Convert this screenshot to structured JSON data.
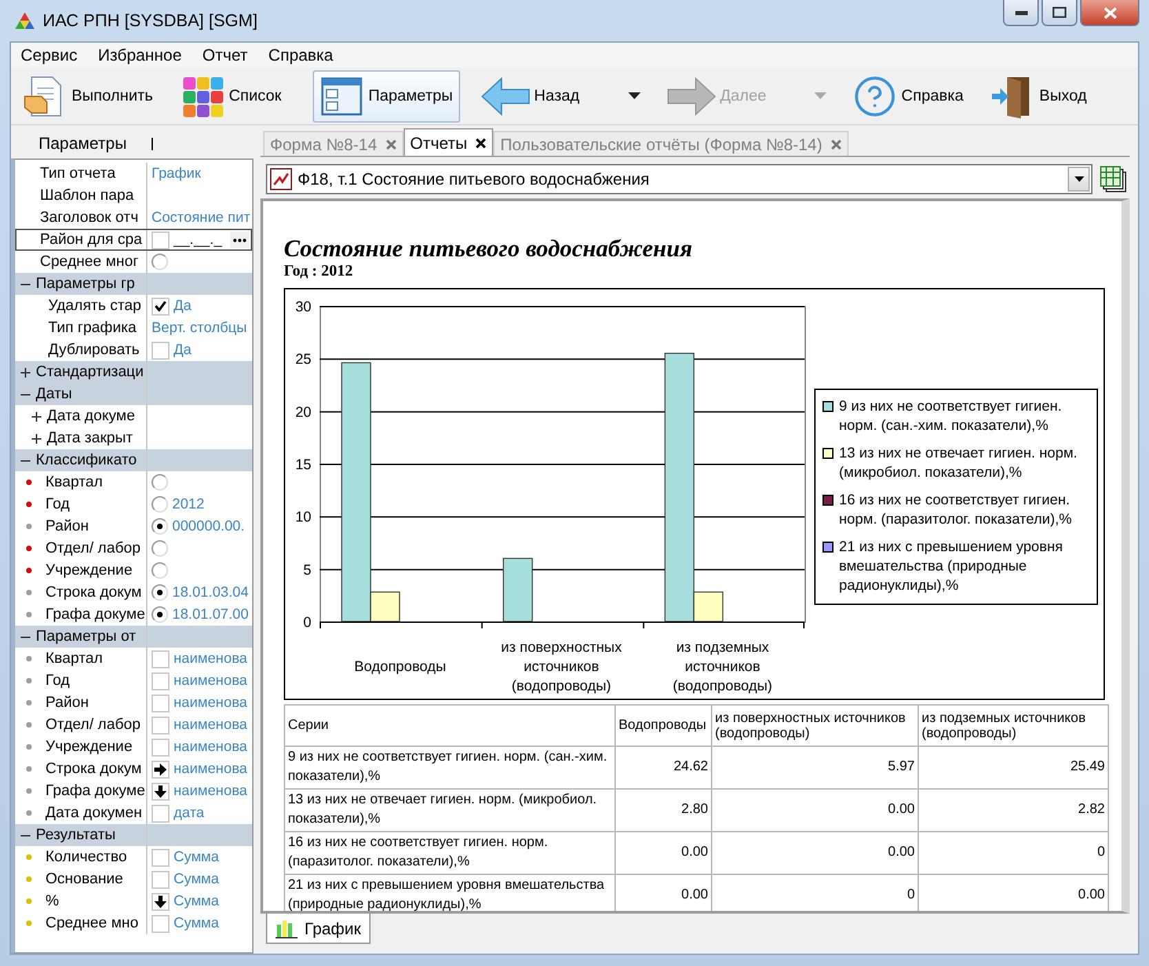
{
  "window": {
    "title": "ИАС РПН [SYSDBA] [SGM]"
  },
  "menu": [
    "Сервис",
    "Избранное",
    "Отчет",
    "Справка"
  ],
  "toolbar": [
    {
      "label": "Выполнить",
      "selected": false,
      "disabled": false,
      "dropdown": false
    },
    {
      "label": "Список",
      "selected": false,
      "disabled": false,
      "dropdown": false
    },
    {
      "label": "Параметры",
      "selected": true,
      "disabled": false,
      "dropdown": false
    },
    {
      "label": "Назад",
      "selected": false,
      "disabled": false,
      "dropdown": true
    },
    {
      "label": "Далее",
      "selected": false,
      "disabled": true,
      "dropdown": true
    },
    {
      "label": "Справка",
      "selected": false,
      "disabled": false,
      "dropdown": false
    },
    {
      "label": "Выход",
      "selected": false,
      "disabled": false,
      "dropdown": false
    }
  ],
  "params": {
    "title": "Параметры",
    "rows": [
      {
        "kind": "field",
        "label": "Тип отчета",
        "value": "График",
        "selected": false
      },
      {
        "kind": "field",
        "label": "Шаблон пара",
        "selected": false
      },
      {
        "kind": "field",
        "label": "Заголовок отч",
        "value": "Состояние пит",
        "selected": false
      },
      {
        "kind": "field",
        "label": "Район для сра",
        "control": {
          "kind": "checkbox",
          "checked": false
        },
        "placeholder": "__.__._",
        "browse_button": true,
        "selected": true
      },
      {
        "kind": "field",
        "label": "Среднее мног",
        "control": {
          "kind": "radio",
          "checked": false
        },
        "selected": false
      },
      {
        "kind": "group",
        "label": "Параметры гр",
        "expanded": true,
        "selected": false,
        "children": [
          {
            "kind": "field",
            "label": "Удалять стар",
            "control": {
              "kind": "checkbox",
              "checked": true
            },
            "value": "Да",
            "selected": false
          },
          {
            "kind": "field",
            "label": "Тип графика",
            "value": "Верт. столбцы",
            "selected": false
          },
          {
            "kind": "field",
            "label": "Дублировать",
            "control": {
              "kind": "checkbox",
              "checked": false
            },
            "value": "Да",
            "selected": false
          }
        ]
      },
      {
        "kind": "group",
        "label": "Стандартизаци",
        "expanded": false,
        "selected": false
      },
      {
        "kind": "group",
        "label": "Даты",
        "expanded": true,
        "selected": false,
        "children": [
          {
            "kind": "group",
            "label": "Дата докуме",
            "expanded": false,
            "selected": false
          },
          {
            "kind": "group",
            "label": "Дата закрыт",
            "expanded": false,
            "selected": false
          }
        ]
      },
      {
        "kind": "group",
        "label": "Классификато",
        "expanded": true,
        "selected": false,
        "children": [
          {
            "kind": "field",
            "label": "Квартал",
            "color": "#d01010",
            "control": {
              "kind": "radio",
              "checked": false
            },
            "selected": false
          },
          {
            "kind": "field",
            "label": "Год",
            "color": "#d01010",
            "control": {
              "kind": "radio",
              "checked": false
            },
            "value": "2012",
            "selected": false
          },
          {
            "kind": "field",
            "label": "Район",
            "color": "#a0a0a0",
            "control": {
              "kind": "radio",
              "checked": true
            },
            "value": "000000.00.",
            "selected": false
          },
          {
            "kind": "field",
            "label": "Отдел/ лабор",
            "color": "#d01010",
            "control": {
              "kind": "radio",
              "checked": false
            },
            "selected": false
          },
          {
            "kind": "field",
            "label": "Учреждение",
            "color": "#d01010",
            "control": {
              "kind": "radio",
              "checked": false
            },
            "selected": false
          },
          {
            "kind": "field",
            "label": "Строка докум",
            "color": "#a0a0a0",
            "control": {
              "kind": "radio",
              "checked": true
            },
            "value": "18.01.03.04",
            "selected": false
          },
          {
            "kind": "field",
            "label": "Графа докуме",
            "color": "#a0a0a0",
            "control": {
              "kind": "radio",
              "checked": true
            },
            "value": "18.01.07.00",
            "selected": false
          }
        ]
      },
      {
        "kind": "group",
        "label": "Параметры от",
        "expanded": true,
        "selected": false,
        "children": [
          {
            "kind": "field",
            "label": "Квартал",
            "color": "#a0a0a0",
            "control": {
              "kind": "checkbox",
              "checked": false
            },
            "value": "наименова",
            "selected": false
          },
          {
            "kind": "field",
            "label": "Год",
            "color": "#a0a0a0",
            "control": {
              "kind": "checkbox",
              "checked": false
            },
            "value": "наименова",
            "selected": false
          },
          {
            "kind": "field",
            "label": "Район",
            "color": "#a0a0a0",
            "control": {
              "kind": "checkbox",
              "checked": false
            },
            "value": "наименова",
            "selected": false
          },
          {
            "kind": "field",
            "label": "Отдел/ лабор",
            "color": "#a0a0a0",
            "control": {
              "kind": "checkbox",
              "checked": false
            },
            "value": "наименова",
            "selected": false
          },
          {
            "kind": "field",
            "label": "Учреждение",
            "color": "#a0a0a0",
            "control": {
              "kind": "checkbox",
              "checked": false
            },
            "value": "наименова",
            "selected": false
          },
          {
            "kind": "field",
            "label": "Строка докум",
            "color": "#a0a0a0",
            "control": {
              "kind": "arrow_right"
            },
            "value": "наименова",
            "selected": false
          },
          {
            "kind": "field",
            "label": "Графа докуме",
            "color": "#a0a0a0",
            "control": {
              "kind": "arrow_down"
            },
            "value": "наименова",
            "selected": false
          },
          {
            "kind": "field",
            "label": "Дата докумен",
            "color": "#a0a0a0",
            "control": {
              "kind": "checkbox",
              "checked": false
            },
            "value": "дата",
            "selected": false
          }
        ]
      },
      {
        "kind": "group",
        "label": "Результаты",
        "expanded": true,
        "selected": false,
        "children": [
          {
            "kind": "field",
            "label": "Количество",
            "color": "#d4c400",
            "control": {
              "kind": "checkbox",
              "checked": false
            },
            "value": "Сумма",
            "selected": false
          },
          {
            "kind": "field",
            "label": "Основание",
            "color": "#d4c400",
            "control": {
              "kind": "checkbox",
              "checked": false
            },
            "value": "Сумма",
            "selected": false
          },
          {
            "kind": "field",
            "label": "%",
            "color": "#d4c400",
            "control": {
              "kind": "arrow_down"
            },
            "value": "Сумма",
            "selected": false
          },
          {
            "kind": "field",
            "label": "Среднее мно",
            "color": "#d4c400",
            "control": {
              "kind": "checkbox",
              "checked": false
            },
            "value": "Сумма",
            "selected": false
          }
        ]
      }
    ]
  },
  "tabs": [
    {
      "label": "Форма №8-14",
      "selected": false
    },
    {
      "label": "Отчеты",
      "selected": true
    },
    {
      "label": "Пользовательские отчёты (Форма №8-14)",
      "selected": false
    }
  ],
  "report_selector": {
    "value": "Ф18, т.1 Состояние питьевого водоснабжения"
  },
  "report": {
    "title": "Состояние питьевого водоснабжения",
    "subtitle": "Год : 2012",
    "chart_data": {
      "type": "bar",
      "categories": [
        "Водопроводы",
        "из поверхностных источников (водопроводы)",
        "из подземных источников (водопроводы)"
      ],
      "series": [
        {
          "name": "9 из них не соответствует гигиен. норм. (сан.-хим. показатели),%",
          "color": "#a6dedc",
          "values": [
            24.6,
            6,
            25.5
          ]
        },
        {
          "name": "13 из них не отвечает гигиен. норм. (микробиол. показатели),%",
          "color": "#ffffc0",
          "values": [
            2.8,
            0,
            2.8
          ]
        },
        {
          "name": "16 из них не соответствует гигиен. норм. (паразитолог. показатели),%",
          "color": "#7a2048",
          "values": [
            0,
            0,
            0
          ]
        },
        {
          "name": "21 из них с превышением уровня вмешательства (природные радионуклиды),%",
          "color": "#9999ff",
          "values": [
            0,
            0,
            0
          ]
        }
      ],
      "ylim": [
        0,
        30
      ],
      "yticks": [
        0,
        5,
        10,
        15,
        20,
        25,
        30
      ],
      "grid": true,
      "legend": true
    },
    "table": {
      "columns": [
        "Серии",
        "Водопроводы",
        "из поверхностных источников (водопроводы)",
        "из подземных источников (водопроводы)"
      ],
      "rows": [
        [
          "9 из них не соответствует гигиен. норм. (сан.-хим. показатели),%",
          "24.62",
          "5.97",
          "25.49"
        ],
        [
          "13 из них не отвечает гигиен. норм. (микробиол. показатели),%",
          "2.80",
          "0.00",
          "2.82"
        ],
        [
          "16 из них не соответствует гигиен. норм. (паразитолог. показатели),%",
          "0.00",
          "0.00",
          "0"
        ],
        [
          "21 из них с превышением уровня вмешательства (природные радионуклиды),%",
          "0.00",
          "0",
          "0.00"
        ]
      ]
    }
  },
  "bottom_tabs": [
    {
      "label": "График",
      "selected": true
    }
  ]
}
